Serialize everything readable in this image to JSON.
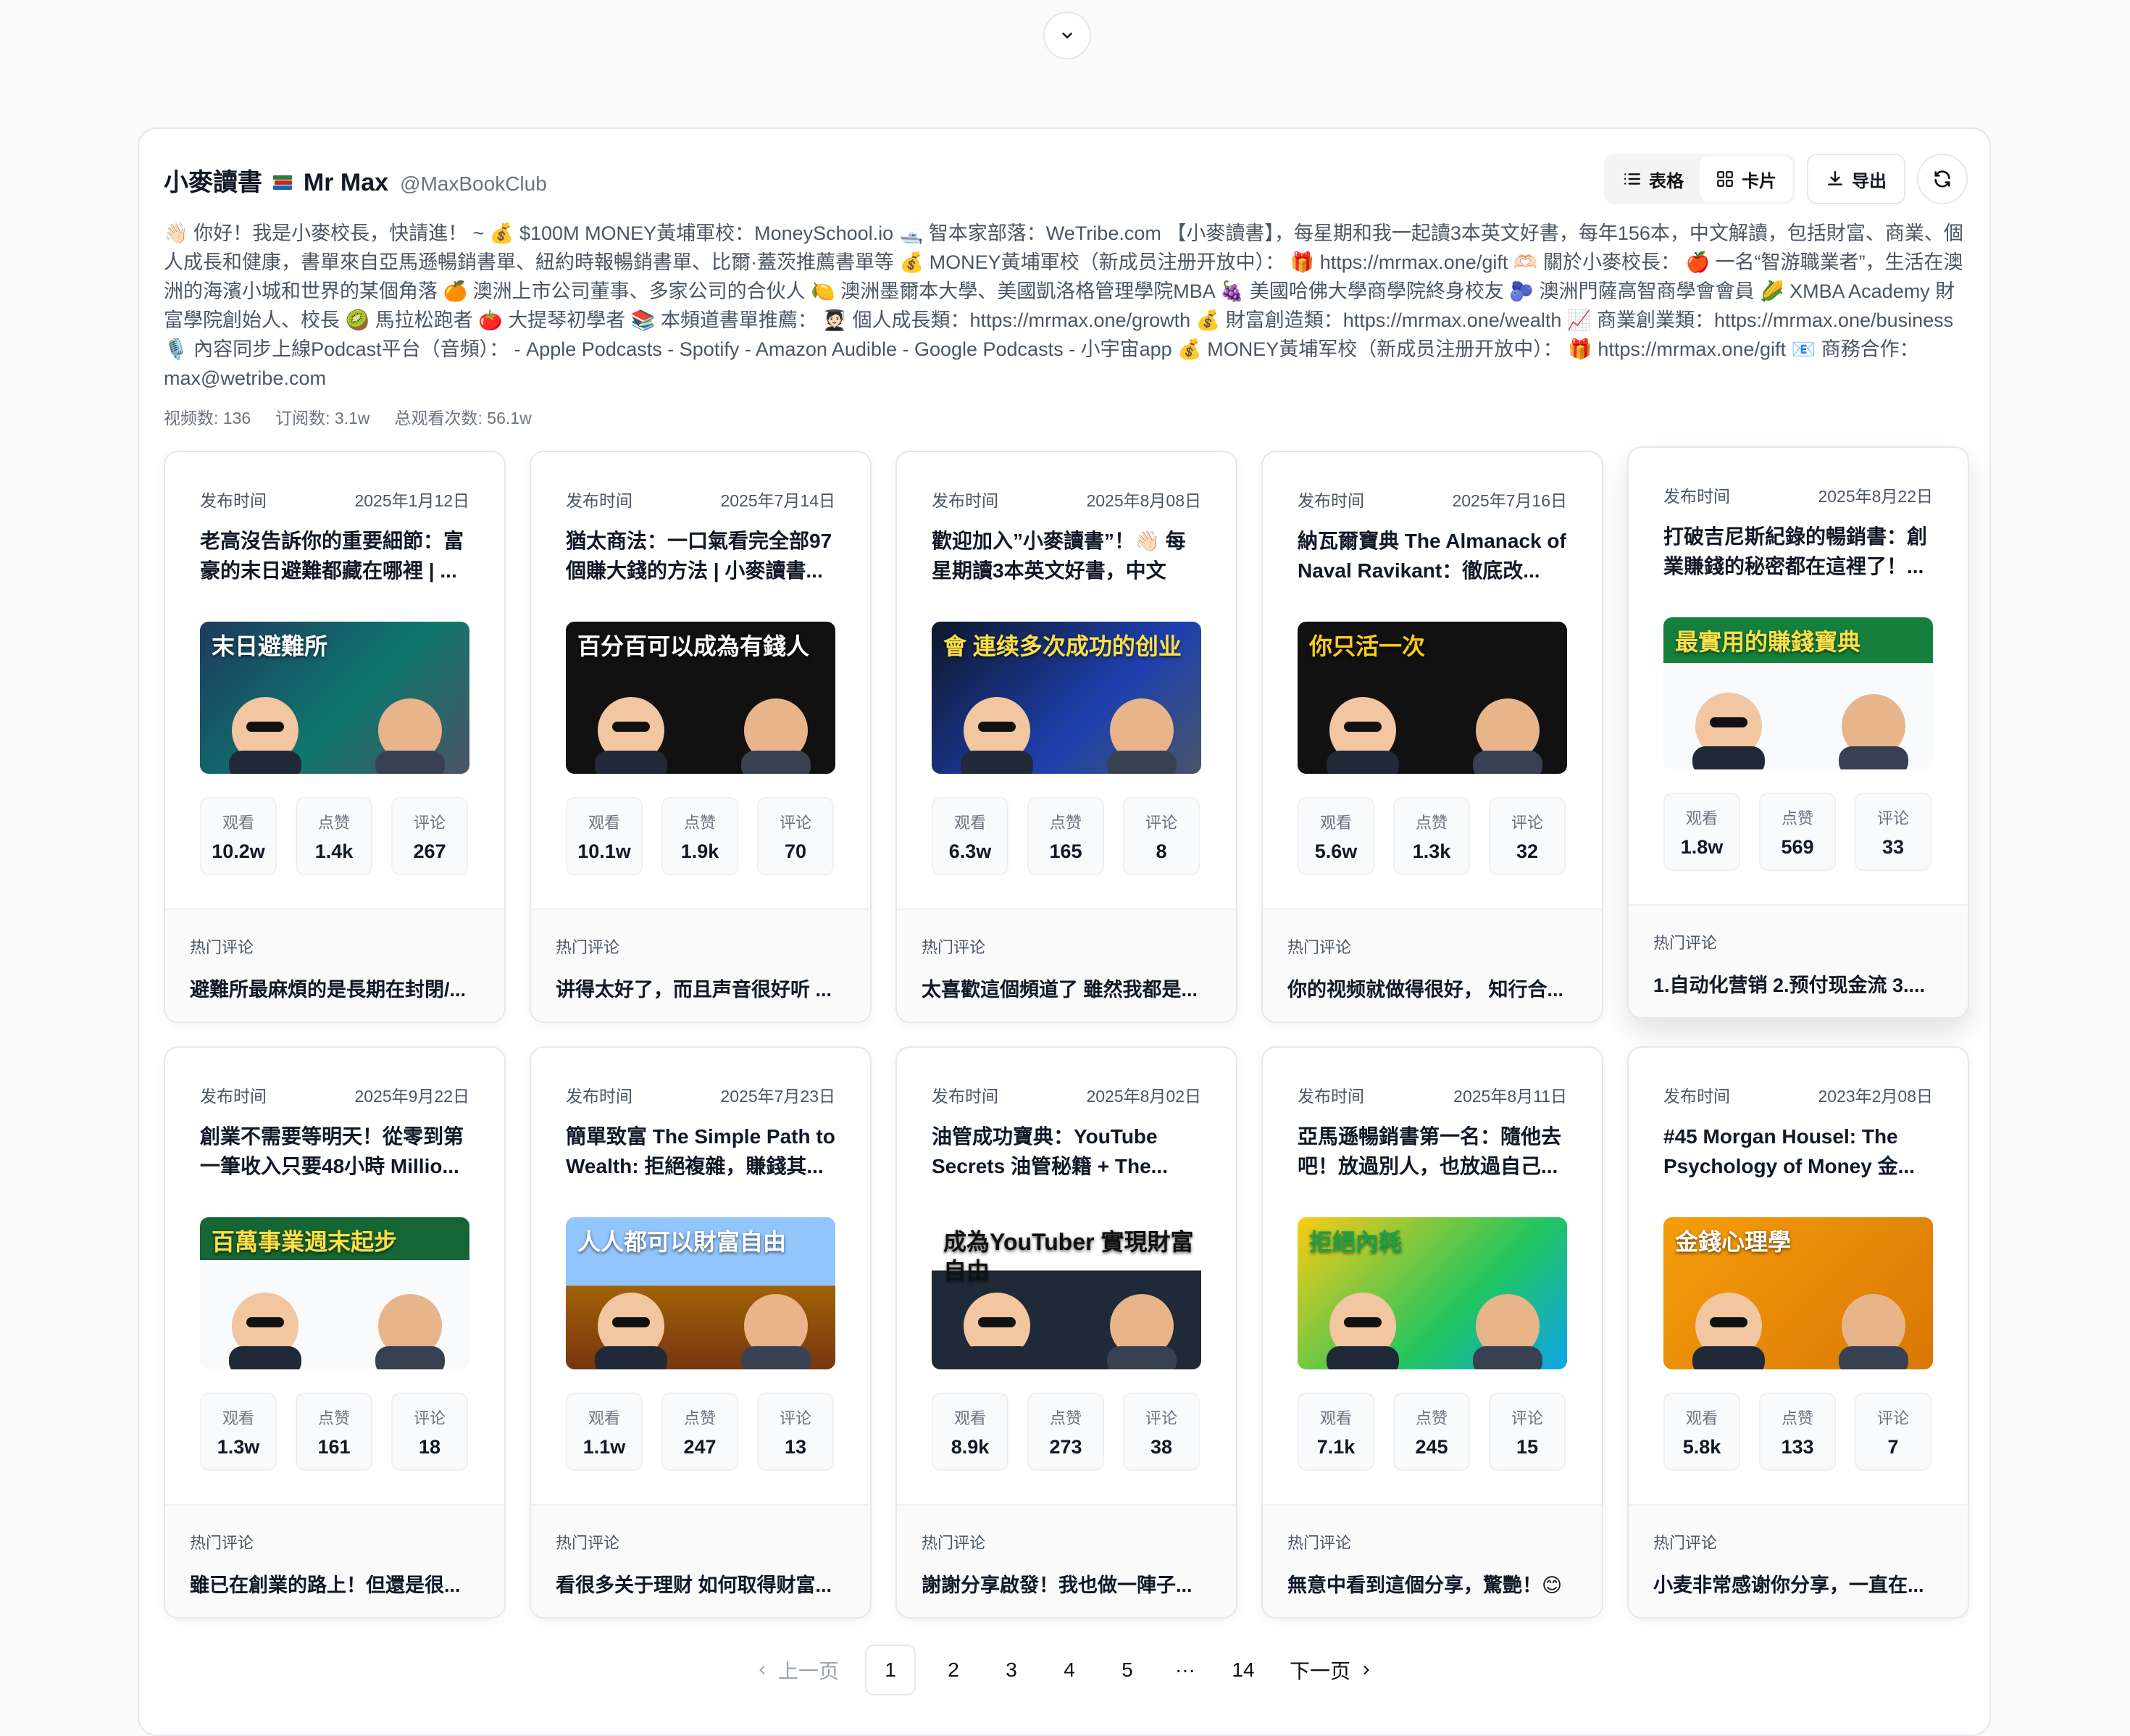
{
  "channel": {
    "name": "小麥讀書 📚 Mr Max",
    "name_pre": "小麥讀書",
    "name_post": "Mr Max",
    "handle": "@MaxBookClub",
    "description": "👋🏻 你好！我是小麥校長，快請進！ ~ 💰 $100M MONEY黃埔軍校：MoneySchool.io 🛥️ 智本家部落：WeTribe.com 【小麥讀書】，每星期和我一起讀3本英文好書，每年156本，中文解讀，包括財富、商業、個人成長和健康，書單來自亞馬遜暢銷書單、紐約時報暢銷書單、比爾·蓋茨推薦書單等 💰 MONEY黃埔軍校（新成员注册开放中）： 🎁 https://mrmax.one/gift 🫶🏻 關於小麥校長： 🍎 一名“智游職業者”，生活在澳洲的海濱小城和世界的某個角落 🍊 澳洲上市公司董事、多家公司的合伙人 🍋 澳洲墨爾本大學、美國凱洛格管理學院MBA 🍇 美國哈佛大學商學院終身校友 🫐 澳洲門薩高智商學會會員 🌽 XMBA Academy 財富學院創始人、校長 🥝 馬拉松跑者 🍅 大提琴初學者 📚 本頻道書單推薦： 🧑🏻‍🎓 個人成長類：https://mrmax.one/growth 💰 財富創造類：https://mrmax.one/wealth 📈 商業創業類：https://mrmax.one/business 🎙️ 內容同步上線Podcast平台（音頻）： - Apple Podcasts - Spotify - Amazon Audible - Google Podcasts - 小宇宙app 💰 MONEY黃埔军校（新成员注册开放中）： 🎁 https://mrmax.one/gift 📧 商務合作：max@wetribe.com",
    "stats": {
      "videos": "视频数: 136",
      "subscribers": "订阅数: 3.1w",
      "total_views": "总观看次数: 56.1w"
    }
  },
  "toolbar": {
    "table_label": "表格",
    "cards_label": "卡片",
    "export_label": "导出"
  },
  "labels": {
    "publish_time": "发布时间",
    "views": "观看",
    "likes": "点赞",
    "comments": "评论",
    "hot_comment": "热门评论"
  },
  "videos": [
    {
      "date": "2025年1月12日",
      "title": "老高沒告訴你的重要細節：富豪的末日避難都藏在哪裡 | ...",
      "thumb_text": "末日避難所",
      "views": "10.2w",
      "likes": "1.4k",
      "comments": "267",
      "hot_comment": "避難所最麻煩的是長期在封閉/..."
    },
    {
      "date": "2025年7月14日",
      "title": "猶太商法：一口氣看完全部97個賺大錢的方法 | 小麥讀書...",
      "thumb_text": "百分百可以成為有錢人",
      "views": "10.1w",
      "likes": "1.9k",
      "comments": "70",
      "hot_comment": "讲得太好了，而且声音很好听 ..."
    },
    {
      "date": "2025年8月08日",
      "title": "歡迎加入”小麥讀書”！👋🏻 每星期讀3本英文好書，中文解...",
      "thumb_text": "會 連续多次成功的创业",
      "views": "6.3w",
      "likes": "165",
      "comments": "8",
      "hot_comment": "太喜歡這個頻道了 雖然我都是..."
    },
    {
      "date": "2025年7月16日",
      "title": "納瓦爾寶典 The Almanack of Naval Ravikant：徹底改...",
      "thumb_text": "你只活一次",
      "views": "5.6w",
      "likes": "1.3k",
      "comments": "32",
      "hot_comment": "你的视频就做得很好， 知行合..."
    },
    {
      "date": "2025年8月22日",
      "title": "打破吉尼斯紀錄的暢銷書：創業賺錢的秘密都在這裡了！...",
      "thumb_text": "最實用的賺錢寶典",
      "views": "1.8w",
      "likes": "569",
      "comments": "33",
      "hot_comment": "1.自动化营销 2.预付现金流 3...."
    },
    {
      "date": "2025年9月22日",
      "title": "創業不需要等明天！從零到第一筆收入只要48小時 Millio...",
      "thumb_text": "百萬事業週末起步",
      "views": "1.3w",
      "likes": "161",
      "comments": "18",
      "hot_comment": "雖已在創業的路上！但還是很..."
    },
    {
      "date": "2025年7月23日",
      "title": "簡單致富 The Simple Path to Wealth: 拒絕複雜，賺錢其...",
      "thumb_text": "人人都可以財富自由",
      "views": "1.1w",
      "likes": "247",
      "comments": "13",
      "hot_comment": "看很多关于理财 如何取得财富..."
    },
    {
      "date": "2025年8月02日",
      "title": "油管成功寶典：YouTube Secrets 油管秘籍 + The...",
      "thumb_text": "成為YouTuber 實現財富自由",
      "views": "8.9k",
      "likes": "273",
      "comments": "38",
      "hot_comment": "謝謝分享啟發！我也做一陣子..."
    },
    {
      "date": "2025年8月11日",
      "title": "亞馬遜暢銷書第一名：隨他去吧！放過別人，也放過自己...",
      "thumb_text": "拒絕內耗",
      "views": "7.1k",
      "likes": "245",
      "comments": "15",
      "hot_comment": "無意中看到這個分享，驚艷！😊"
    },
    {
      "date": "2023年2月08日",
      "title": "#45 Morgan Housel: The Psychology of Money 金...",
      "thumb_text": "金錢心理學",
      "views": "5.8k",
      "likes": "133",
      "comments": "7",
      "hot_comment": "小麦非常感谢你分享，一直在..."
    }
  ],
  "pagination": {
    "prev": "上一页",
    "next": "下一页",
    "pages": [
      "1",
      "2",
      "3",
      "4",
      "5",
      "···",
      "14"
    ],
    "current": "1"
  }
}
